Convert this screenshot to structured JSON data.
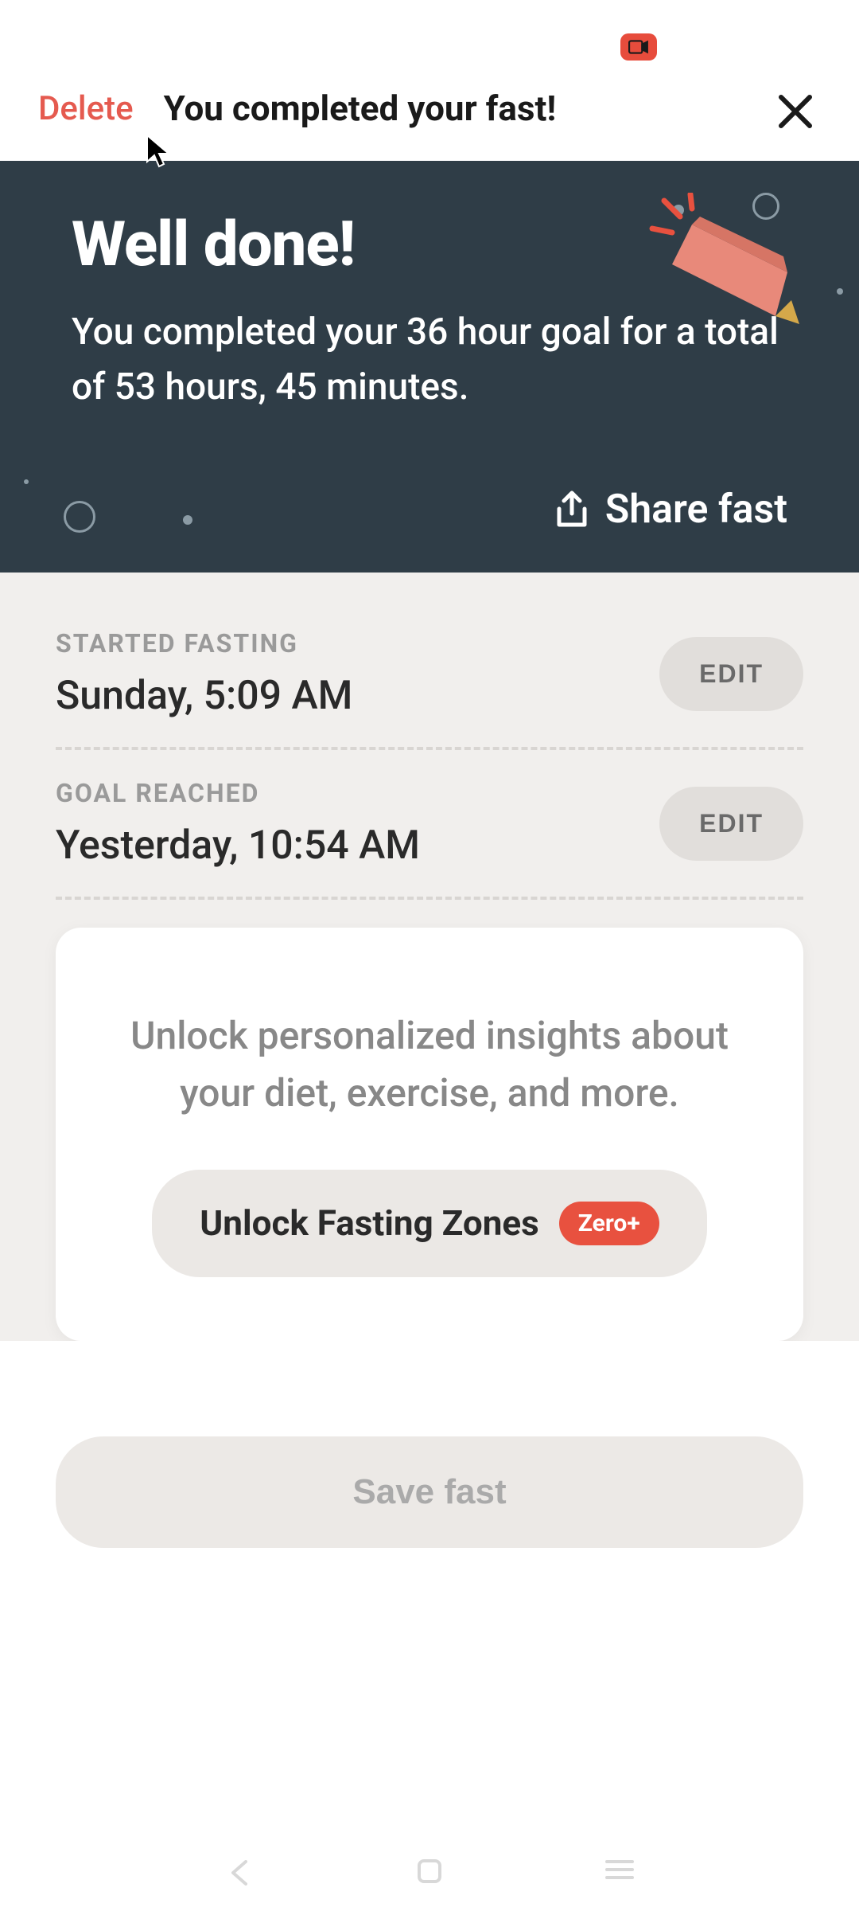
{
  "header": {
    "delete_label": "Delete",
    "title": "You completed your fast!"
  },
  "hero": {
    "title": "Well done!",
    "subtitle": "You completed your 36 hour goal for a total of 53 hours, 45 minutes.",
    "share_label": "Share fast"
  },
  "info": {
    "started": {
      "label": "STARTED FASTING",
      "value": "Sunday, 5:09 AM",
      "edit": "EDIT"
    },
    "goal": {
      "label": "GOAL REACHED",
      "value": "Yesterday, 10:54 AM",
      "edit": "EDIT"
    }
  },
  "promo": {
    "text": "Unlock personalized insights about your diet, exercise, and more.",
    "button_label": "Unlock Fasting Zones",
    "badge": "Zero+"
  },
  "save": {
    "label": "Save fast"
  }
}
